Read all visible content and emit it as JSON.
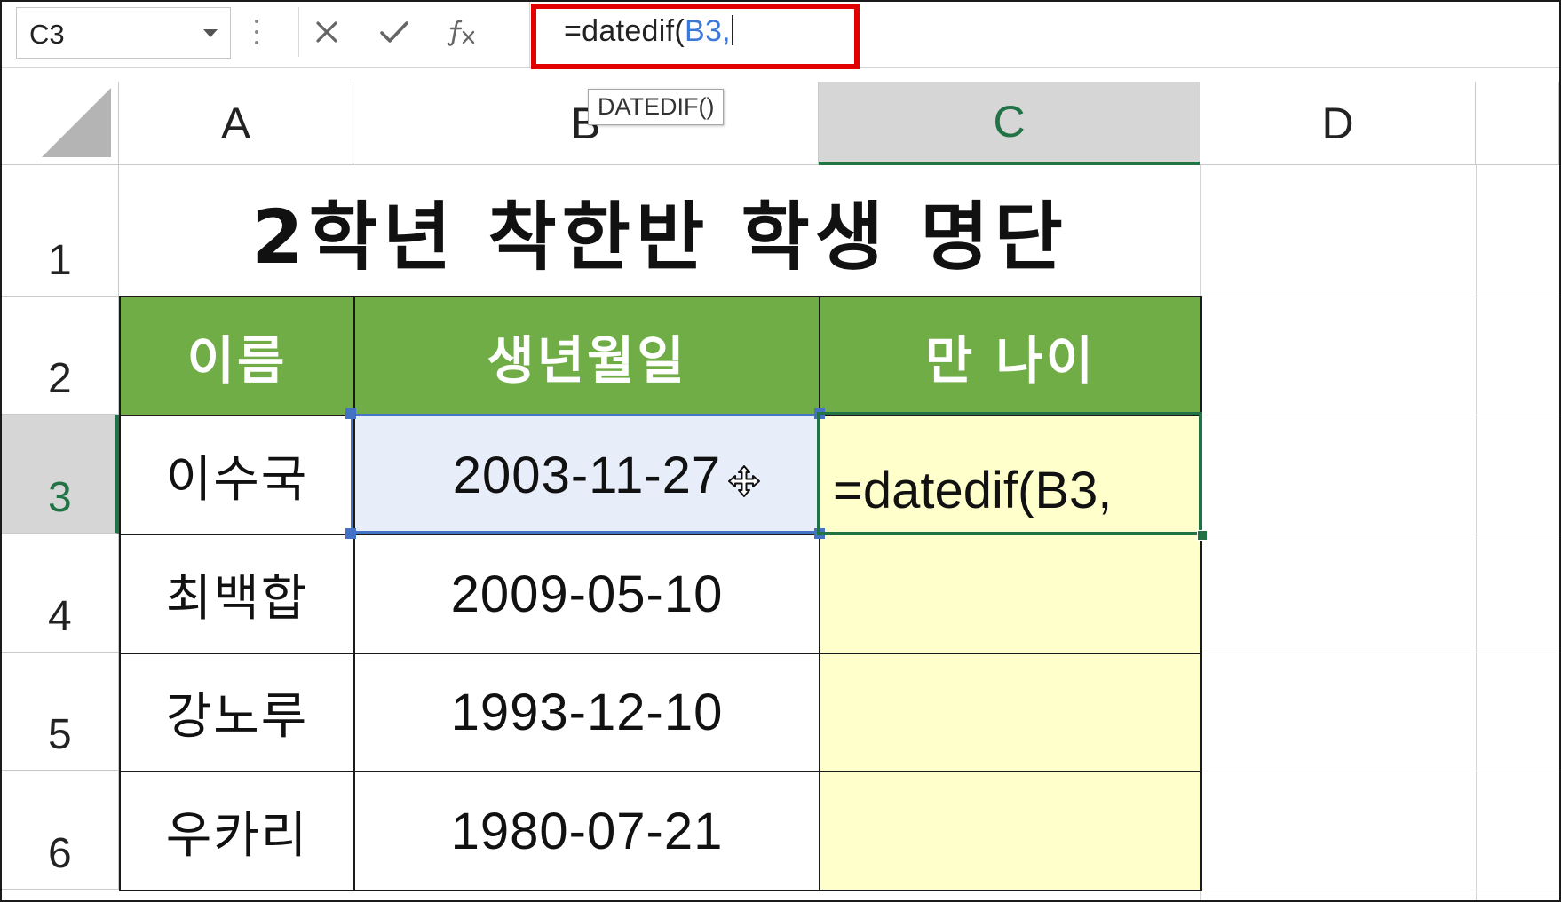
{
  "formula_bar": {
    "name_box": "C3",
    "cancel_icon": "x-icon",
    "enter_icon": "checkmark-icon",
    "function_icon": "fx-icon",
    "formula_prefix": "=datedif(",
    "formula_ref": "B3,"
  },
  "columns": [
    "A",
    "B",
    "C",
    "D"
  ],
  "rows": [
    "1",
    "2",
    "3",
    "4",
    "5",
    "6"
  ],
  "tooltip": "DATEDIF()",
  "sheet": {
    "title": "2학년 착한반 학생 명단",
    "headers": [
      "이름",
      "생년월일",
      "만 나이"
    ],
    "students": [
      {
        "name": "이수국",
        "birth": "2003-11-27"
      },
      {
        "name": "최백합",
        "birth": "2009-05-10"
      },
      {
        "name": "강노루",
        "birth": "1993-12-10"
      },
      {
        "name": "우카리",
        "birth": "1980-07-21"
      }
    ],
    "editing_value": "=datedif(B3,"
  },
  "colors": {
    "header_fill": "#70ad47",
    "age_fill": "#ffffcc",
    "selection_green": "#217346",
    "reference_blue": "#4472c4",
    "highlight_red": "#e00000"
  }
}
